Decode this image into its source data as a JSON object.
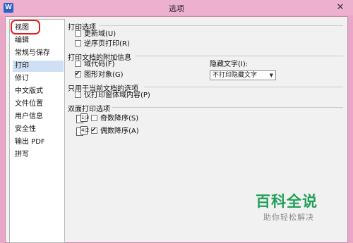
{
  "window": {
    "app_icon": "W",
    "title": "选项",
    "close": "✕"
  },
  "sidebar": {
    "items": [
      {
        "label": "视图"
      },
      {
        "label": "编辑"
      },
      {
        "label": "常规与保存"
      },
      {
        "label": "打印"
      },
      {
        "label": "修订"
      },
      {
        "label": "中文版式"
      },
      {
        "label": "文件位置"
      },
      {
        "label": "用户信息"
      },
      {
        "label": "安全性"
      },
      {
        "label": "输出 PDF"
      },
      {
        "label": "拼写"
      }
    ],
    "active_index": 3
  },
  "print_options": {
    "title": "打印选项",
    "update_fields": {
      "label": "更新域(U)",
      "checked": false
    },
    "reverse_order": {
      "label": "逆序页打印(R)",
      "checked": false
    }
  },
  "extra_info": {
    "title": "打印文档的附加信息",
    "field_codes": {
      "label": "域代码(F)",
      "checked": false
    },
    "drawing_objects": {
      "label": "图形对象(G)",
      "checked": true
    },
    "hidden_text_label": "隐藏文字(I):",
    "hidden_text_value": "不打印隐藏文字"
  },
  "current_doc": {
    "title": "只用于当前文档的选项",
    "form_data_only": {
      "label": "仅打印窗体域内容(P)",
      "checked": false
    }
  },
  "duplex": {
    "title": "双面打印选项",
    "odd": {
      "label": "奇数降序(S)",
      "checked": false,
      "icon_text": "1|3"
    },
    "even": {
      "label": "偶数降序(A)",
      "checked": true,
      "icon_text": "4|2"
    }
  },
  "watermark": {
    "brand": "百科全说",
    "slogan": "助你轻松解决"
  }
}
